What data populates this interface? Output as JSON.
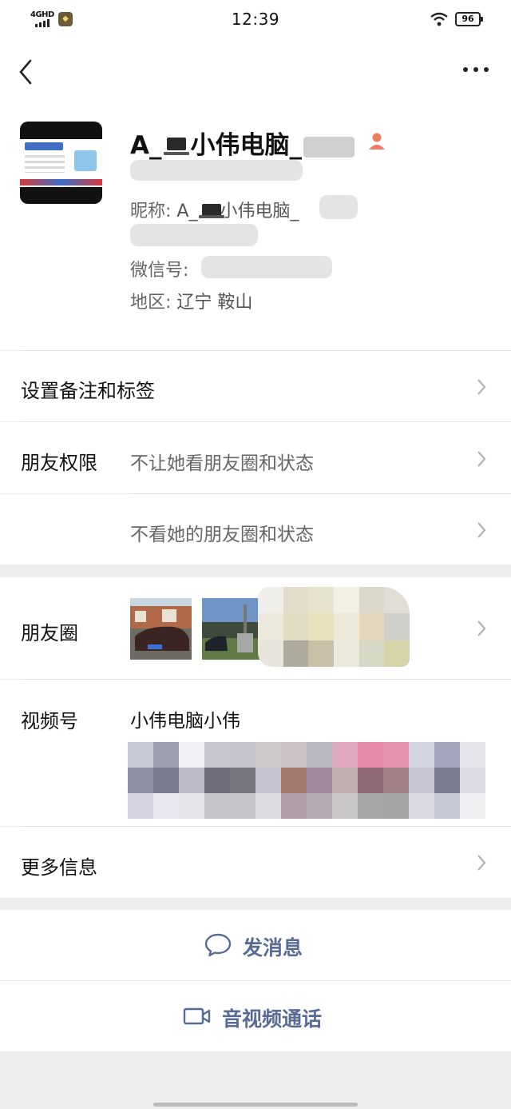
{
  "status_bar": {
    "network": "4GHD",
    "time": "12:39",
    "battery": "96"
  },
  "nav": {
    "back_icon": "chevron-left-icon",
    "more_icon": "more-dots-icon"
  },
  "profile": {
    "name_prefix": "A_",
    "name_main": "小伟电脑_",
    "nickname_label": "昵称: ",
    "nickname_prefix": "A_",
    "nickname_main": "小伟电脑_",
    "wechat_id_label": "微信号: ",
    "region_label": "地区: ",
    "region_value": "辽宁  鞍山"
  },
  "rows": {
    "remark": {
      "label": "设置备注和标签"
    },
    "permissions": {
      "label": "朋友权限",
      "option_1": "不让她看朋友圈和状态",
      "option_2": "不看她的朋友圈和状态"
    },
    "moments": {
      "label": "朋友圈"
    },
    "channels": {
      "label": "视频号",
      "value": "小伟电脑小伟"
    },
    "more_info": {
      "label": "更多信息"
    }
  },
  "actions": {
    "message": "发消息",
    "call": "音视频通话"
  },
  "colors": {
    "link": "#576b95",
    "background": "#ededed"
  }
}
